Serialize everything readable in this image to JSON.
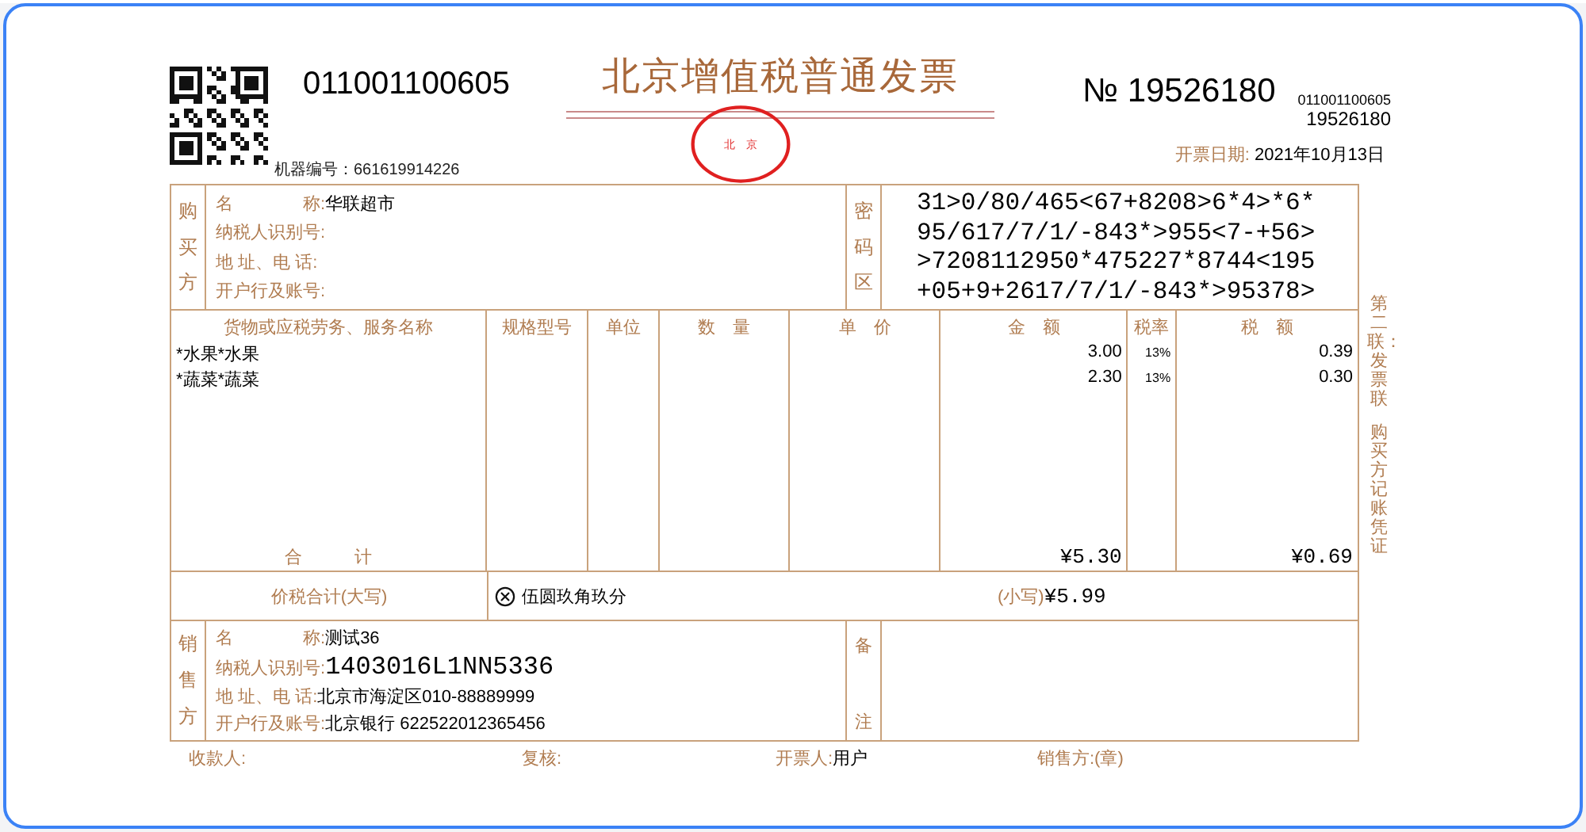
{
  "header": {
    "code": "011001100605",
    "title": "北京增值税普通发票",
    "number_mark": "№",
    "number": "19526180",
    "code_small": "011001100605",
    "number_small": "19526180",
    "machine_label": "机器编号：",
    "machine_number": "661619914226",
    "date_label": "开票日期:",
    "date": "2021年10月13日",
    "stamp_text": "北　京"
  },
  "buyer": {
    "side_label": "购买方",
    "fields": [
      {
        "label": "名　　　　称:",
        "value": "华联超市"
      },
      {
        "label": "纳税人识别号:"
      },
      {
        "label": "地 址、电 话:"
      },
      {
        "label": "开户行及账号:"
      }
    ],
    "cipher_label": "密码区",
    "cipher_lines": [
      "31>0/80/465<67+8208>6*4>*6*",
      "95/617/7/1/-843*>955<7-+56>",
      ">7208112950*475227*8744<195",
      "+05+9+2617/7/1/-843*>95378>"
    ]
  },
  "items": {
    "columns": [
      "货物或应税劳务、服务名称",
      "规格型号",
      "单位",
      "数　量",
      "单　价",
      "金　额",
      "税率",
      "税　额"
    ],
    "rows": [
      {
        "name": "*水果*水果",
        "amount": "3.00",
        "rate": "13%",
        "tax": "0.39"
      },
      {
        "name": "*蔬菜*蔬菜",
        "amount": "2.30",
        "rate": "13%",
        "tax": "0.30"
      }
    ],
    "total_label": "合　　　计",
    "total_amount": "¥5.30",
    "total_tax": "¥0.69"
  },
  "grand_total": {
    "label": "价税合计(大写)",
    "words": "伍圆玖角玖分",
    "small_label": "(小写)",
    "small_value": "¥5.99"
  },
  "seller": {
    "side_label": "销售方",
    "fields": [
      {
        "label": "名　　　　称:",
        "value": "测试36"
      },
      {
        "label": "纳税人识别号:",
        "value": "1403016L1NN5336",
        "kind": "id"
      },
      {
        "label": "地 址、电 话:",
        "value": "北京市海淀区010-88889999"
      },
      {
        "label": "开户行及账号:",
        "value": "北京银行 622522012365456"
      }
    ],
    "remarks_label": [
      "备",
      "注"
    ]
  },
  "footer": [
    {
      "label": "收款人:"
    },
    {
      "label": "复核:"
    },
    {
      "label": "开票人:",
      "value": "用户"
    },
    {
      "label": "销售方:(章)"
    }
  ],
  "copy_note": [
    "第二联：发票联",
    "购买方记账凭证"
  ]
}
